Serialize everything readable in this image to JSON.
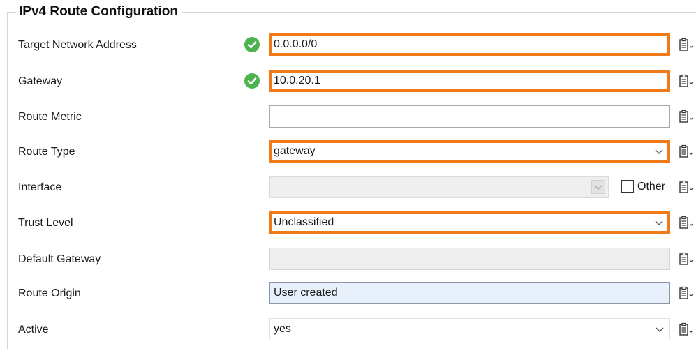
{
  "section": {
    "title": "IPv4 Route Configuration"
  },
  "rows": {
    "target": {
      "label": "Target Network Address",
      "value": "0.0.0.0/0",
      "valid": true
    },
    "gateway": {
      "label": "Gateway",
      "value": "10.0.20.1",
      "valid": true
    },
    "metric": {
      "label": "Route Metric",
      "value": ""
    },
    "route_type": {
      "label": "Route Type",
      "value": "gateway"
    },
    "interface": {
      "label": "Interface",
      "value": "",
      "other_label": "Other",
      "other_checked": false
    },
    "trust": {
      "label": "Trust Level",
      "value": "Unclassified"
    },
    "default_gw": {
      "label": "Default Gateway",
      "value": ""
    },
    "origin": {
      "label": "Route Origin",
      "value": "User created"
    },
    "active": {
      "label": "Active",
      "value": "yes"
    }
  },
  "icons": {
    "valid": "check-circle-icon",
    "clipboard": "clipboard-menu-icon",
    "dropdown": "chevron-down-icon"
  },
  "colors": {
    "highlight": "#f07a18",
    "valid": "#4cb34f",
    "origin_bg": "#e8f1fb"
  }
}
